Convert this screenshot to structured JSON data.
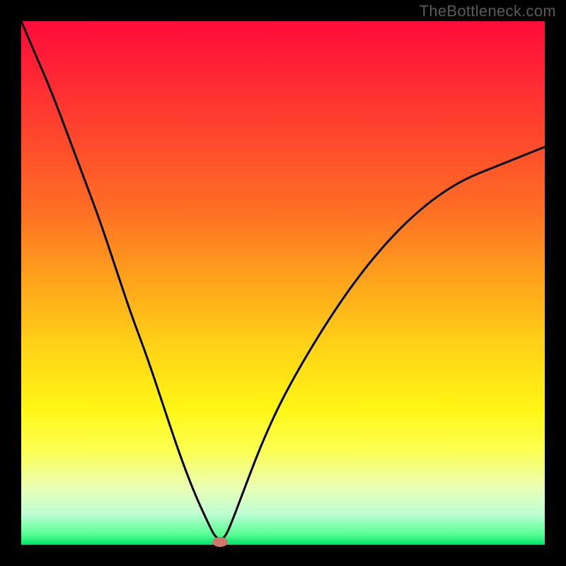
{
  "watermark": "TheBottleneck.com",
  "chart_data": {
    "type": "line",
    "title": "",
    "xlabel": "",
    "ylabel": "",
    "xlim": [
      0,
      100
    ],
    "ylim": [
      0,
      100
    ],
    "grid": false,
    "legend": false,
    "series": [
      {
        "name": "bottleneck-curve",
        "x": [
          0,
          3,
          6,
          9,
          12,
          15,
          18,
          21,
          24,
          27,
          30,
          33,
          36,
          37,
          38,
          39,
          40,
          42,
          45,
          48,
          51,
          55,
          60,
          65,
          70,
          75,
          80,
          85,
          90,
          95,
          100
        ],
        "values": [
          100,
          93,
          86,
          78,
          70,
          62,
          53,
          44,
          36,
          27,
          18,
          10,
          3.5,
          1.6,
          0.9,
          1.6,
          3.8,
          9,
          17,
          24,
          30,
          37,
          45,
          52,
          58,
          63,
          67,
          70,
          72,
          74,
          76
        ]
      }
    ],
    "marker": {
      "x": 38,
      "y": 0.5,
      "color": "#cf766f"
    },
    "background_gradient": {
      "top": "#ff0b3b",
      "bottom": "#00e46a",
      "stops": [
        "#ff0b3b",
        "#ff3c2f",
        "#ff6e24",
        "#ffa51b",
        "#ffd217",
        "#fff615",
        "#fcff52",
        "#eaffb4",
        "#bfffd4",
        "#57ff93",
        "#00e46a"
      ]
    }
  }
}
